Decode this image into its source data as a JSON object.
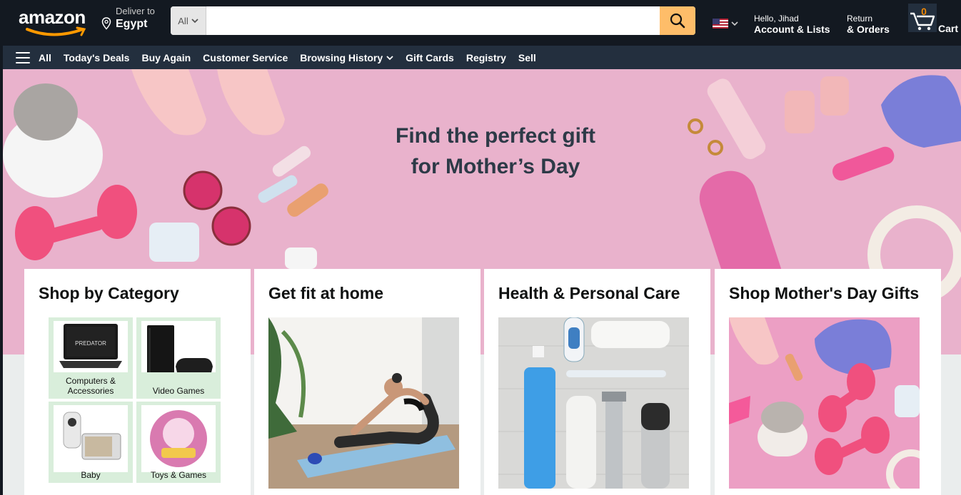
{
  "header": {
    "logo_text": "amazon",
    "deliver_line1": "Deliver to",
    "deliver_line2": "Egypt",
    "search": {
      "category": "All",
      "placeholder": "",
      "value": ""
    },
    "account_line1": "Hello, Jihad",
    "account_line2": "Account & Lists",
    "returns_line1": "Return",
    "returns_line2": "& Orders",
    "cart_count": "0",
    "cart_label": "Cart"
  },
  "nav": {
    "items": [
      "All",
      "Today's Deals",
      "Buy Again",
      "Customer Service",
      "Browsing History",
      "Gift Cards",
      "Registry",
      "Sell"
    ]
  },
  "hero": {
    "title_line1": "Find the perfect gift",
    "title_line2": "for Mother’s Day"
  },
  "cards": [
    {
      "title": "Shop by Category",
      "tiles": [
        {
          "label": "Computers & Accessories",
          "icon": "laptop-icon"
        },
        {
          "label": "Video Games",
          "icon": "game-console-icon"
        },
        {
          "label": "Baby",
          "icon": "baby-monitor-icon"
        },
        {
          "label": "Toys & Games",
          "icon": "toy-ball-icon"
        }
      ],
      "tile_image_text": "PREDATOR"
    },
    {
      "title": "Get fit at home"
    },
    {
      "title": "Health & Personal Care"
    },
    {
      "title": "Shop Mother's Day Gifts"
    }
  ],
  "colors": {
    "header_bg": "#131921",
    "nav_bg": "#232f3e",
    "search_btn": "#febd69",
    "hero_bg": "#e9b2cc",
    "tile_bg": "#d9eedb",
    "cart_count": "#f08804"
  }
}
